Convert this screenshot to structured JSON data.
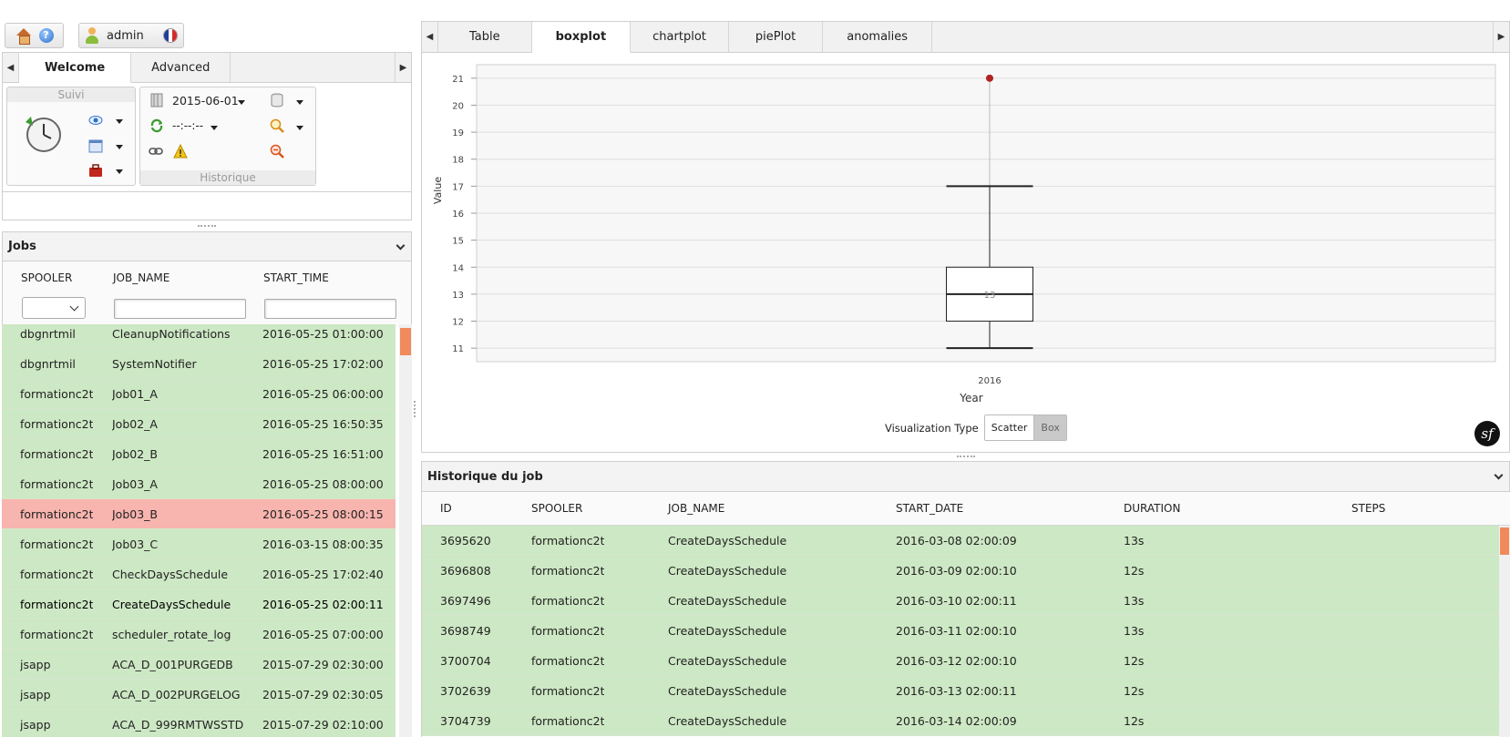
{
  "toolbar": {
    "user": "admin"
  },
  "left_tabs": [
    "Welcome",
    "Advanced"
  ],
  "suivi": {
    "title": "Suivi"
  },
  "historique": {
    "title": "Historique",
    "date": "2015-06-01",
    "time": "--:--:--"
  },
  "jobs": {
    "title": "Jobs",
    "columns": [
      "SPOOLER",
      "JOB_NAME",
      "START_TIME"
    ],
    "rows": [
      {
        "spooler": "dbgnrtmil",
        "job": "CleanupNotifications",
        "start": "2016-05-25 01:00:00",
        "status": "ok"
      },
      {
        "spooler": "dbgnrtmil",
        "job": "SystemNotifier",
        "start": "2016-05-25 17:02:00",
        "status": "ok"
      },
      {
        "spooler": "formationc2t",
        "job": "Job01_A",
        "start": "2016-05-25 06:00:00",
        "status": "ok"
      },
      {
        "spooler": "formationc2t",
        "job": "Job02_A",
        "start": "2016-05-25 16:50:35",
        "status": "ok"
      },
      {
        "spooler": "formationc2t",
        "job": "Job02_B",
        "start": "2016-05-25 16:51:00",
        "status": "ok"
      },
      {
        "spooler": "formationc2t",
        "job": "Job03_A",
        "start": "2016-05-25 08:00:00",
        "status": "ok"
      },
      {
        "spooler": "formationc2t",
        "job": "Job03_B",
        "start": "2016-05-25 08:00:15",
        "status": "error"
      },
      {
        "spooler": "formationc2t",
        "job": "Job03_C",
        "start": "2016-03-15 08:00:35",
        "status": "ok"
      },
      {
        "spooler": "formationc2t",
        "job": "CheckDaysSchedule",
        "start": "2016-05-25 17:02:40",
        "status": "ok"
      },
      {
        "spooler": "formationc2t",
        "job": "CreateDaysSchedule",
        "start": "2016-05-25 02:00:11",
        "status": "selected"
      },
      {
        "spooler": "formationc2t",
        "job": "scheduler_rotate_log",
        "start": "2016-05-25 07:00:00",
        "status": "ok"
      },
      {
        "spooler": "jsapp",
        "job": "ACA_D_001PURGEDB",
        "start": "2015-07-29 02:30:00",
        "status": "ok"
      },
      {
        "spooler": "jsapp",
        "job": "ACA_D_002PURGELOG",
        "start": "2015-07-29 02:30:05",
        "status": "ok"
      },
      {
        "spooler": "jsapp",
        "job": "ACA_D_999RMTWSSTD",
        "start": "2015-07-29 02:10:00",
        "status": "ok"
      }
    ]
  },
  "right_tabs": [
    "Table",
    "boxplot",
    "chartplot",
    "piePlot",
    "anomalies"
  ],
  "active_right_tab": "boxplot",
  "chart_data": {
    "type": "boxplot",
    "categories": [
      "2016"
    ],
    "box": {
      "min": 11,
      "q1": 12,
      "median": 13,
      "q3": 14,
      "max": 17,
      "median_label": "13"
    },
    "outliers": [
      21
    ],
    "xlabel": "Year",
    "ylabel": "Value",
    "yticks": [
      11,
      12,
      13,
      14,
      15,
      16,
      17,
      18,
      19,
      20,
      21
    ],
    "grid": true,
    "outlier_color": "#b22222"
  },
  "viz": {
    "label": "Visualization Type",
    "options": [
      "Scatter",
      "Box"
    ],
    "selected": "Box"
  },
  "history": {
    "title": "Historique du job",
    "columns": [
      "ID",
      "SPOOLER",
      "JOB_NAME",
      "START_DATE",
      "DURATION",
      "STEPS"
    ],
    "rows": [
      {
        "id": "3695620",
        "spooler": "formationc2t",
        "job": "CreateDaysSchedule",
        "start": "2016-03-08 02:00:09",
        "duration": "13s",
        "steps": ""
      },
      {
        "id": "3696808",
        "spooler": "formationc2t",
        "job": "CreateDaysSchedule",
        "start": "2016-03-09 02:00:10",
        "duration": "12s",
        "steps": ""
      },
      {
        "id": "3697496",
        "spooler": "formationc2t",
        "job": "CreateDaysSchedule",
        "start": "2016-03-10 02:00:11",
        "duration": "13s",
        "steps": ""
      },
      {
        "id": "3698749",
        "spooler": "formationc2t",
        "job": "CreateDaysSchedule",
        "start": "2016-03-11 02:00:10",
        "duration": "13s",
        "steps": ""
      },
      {
        "id": "3700704",
        "spooler": "formationc2t",
        "job": "CreateDaysSchedule",
        "start": "2016-03-12 02:00:10",
        "duration": "12s",
        "steps": ""
      },
      {
        "id": "3702639",
        "spooler": "formationc2t",
        "job": "CreateDaysSchedule",
        "start": "2016-03-13 02:00:11",
        "duration": "12s",
        "steps": ""
      },
      {
        "id": "3704739",
        "spooler": "formationc2t",
        "job": "CreateDaysSchedule",
        "start": "2016-03-14 02:00:09",
        "duration": "12s",
        "steps": ""
      }
    ]
  },
  "colors": {
    "row_ok": "#cde8c4",
    "row_error": "#f8b4ae",
    "accent": "#f08a5d"
  }
}
